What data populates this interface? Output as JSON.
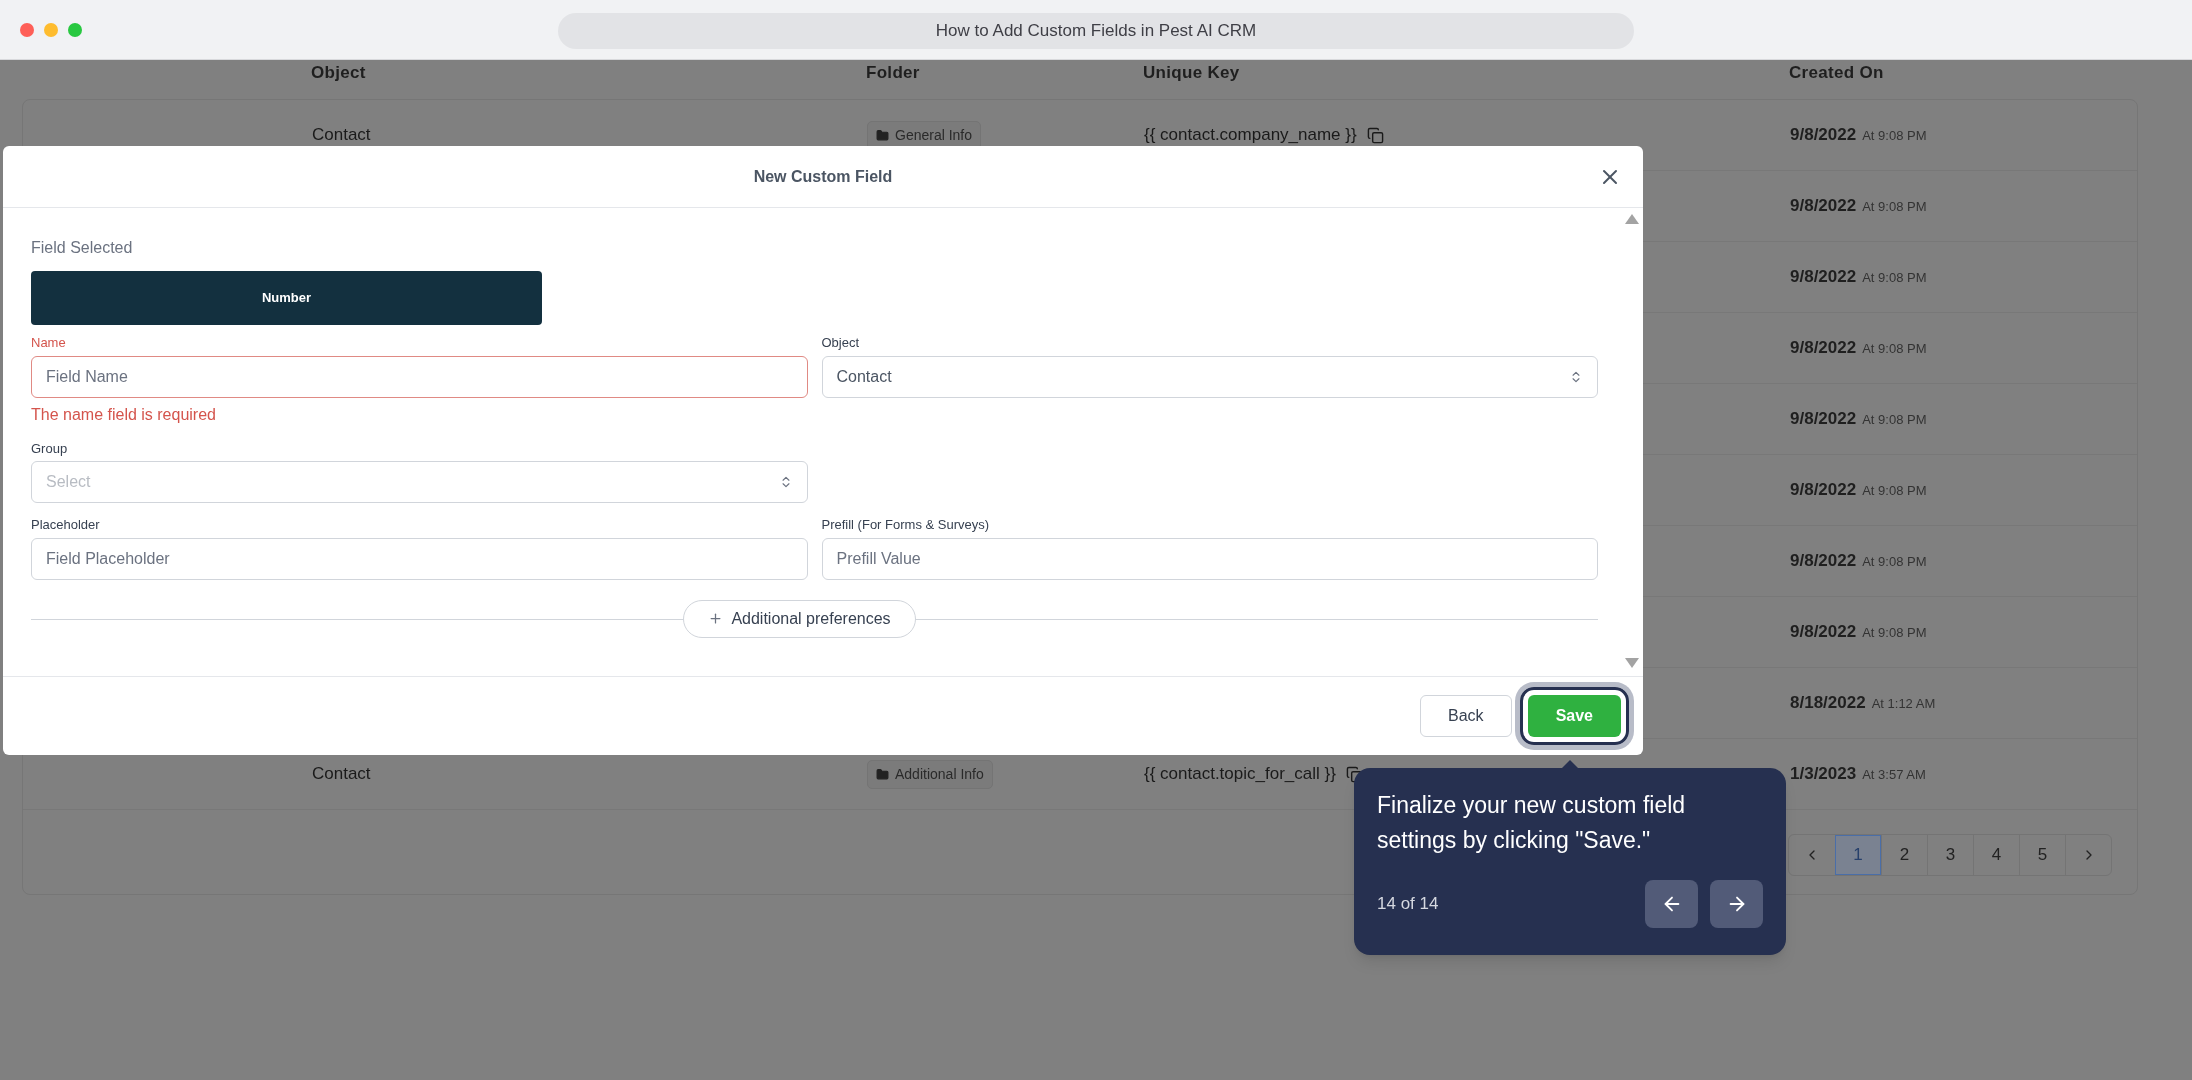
{
  "window": {
    "title": "How to Add Custom Fields in Pest AI CRM"
  },
  "table": {
    "columns": [
      "Object",
      "Folder",
      "Unique Key",
      "Created On"
    ],
    "rows": [
      {
        "object": "Contact",
        "folder": "General Info",
        "unique_key": "{{ contact.company_name }}",
        "date": "9/8/2022",
        "time": "At 9:08 PM"
      },
      {
        "date": "9/8/2022",
        "time": "At 9:08 PM"
      },
      {
        "date": "9/8/2022",
        "time": "At 9:08 PM"
      },
      {
        "date": "9/8/2022",
        "time": "At 9:08 PM"
      },
      {
        "date": "9/8/2022",
        "time": "At 9:08 PM"
      },
      {
        "date": "9/8/2022",
        "time": "At 9:08 PM"
      },
      {
        "date": "9/8/2022",
        "time": "At 9:08 PM"
      },
      {
        "date": "9/8/2022",
        "time": "At 9:08 PM"
      },
      {
        "date": "8/18/2022",
        "time": "At 1:12 AM"
      },
      {
        "object": "Contact",
        "folder": "Additional Info",
        "unique_key": "{{ contact.topic_for_call }}",
        "date": "1/3/2023",
        "time": "At 3:57 AM"
      }
    ]
  },
  "pagination": {
    "pages": [
      {
        "label": "1",
        "selected": true
      },
      {
        "label": "2",
        "selected": false
      },
      {
        "label": "3",
        "selected": false
      },
      {
        "label": "4",
        "selected": false
      },
      {
        "label": "5",
        "selected": false
      }
    ]
  },
  "modal": {
    "title": "New Custom Field",
    "field_selected_label": "Field Selected",
    "field_type": "Number",
    "rows": [
      [
        {
          "kind": "text",
          "label": "Name",
          "placeholder": "Field Name",
          "error": "The name field is required"
        },
        {
          "kind": "select",
          "label": "Object",
          "value": "Contact"
        }
      ],
      [
        {
          "kind": "select",
          "label": "Group",
          "placeholder": "Select"
        }
      ],
      [
        {
          "kind": "text",
          "label": "Placeholder",
          "placeholder": "Field Placeholder"
        },
        {
          "kind": "text",
          "label": "Prefill (For Forms & Surveys)",
          "placeholder": "Prefill Value"
        }
      ]
    ],
    "additional_button": "Additional preferences",
    "buttons": [
      {
        "label": "Back",
        "kind": "secondary",
        "highlighted": false
      },
      {
        "label": "Save",
        "kind": "primary",
        "highlighted": true
      }
    ]
  },
  "tour": {
    "text": "Finalize your new custom field settings by clicking \"Save.\"",
    "step": "14 of 14"
  }
}
